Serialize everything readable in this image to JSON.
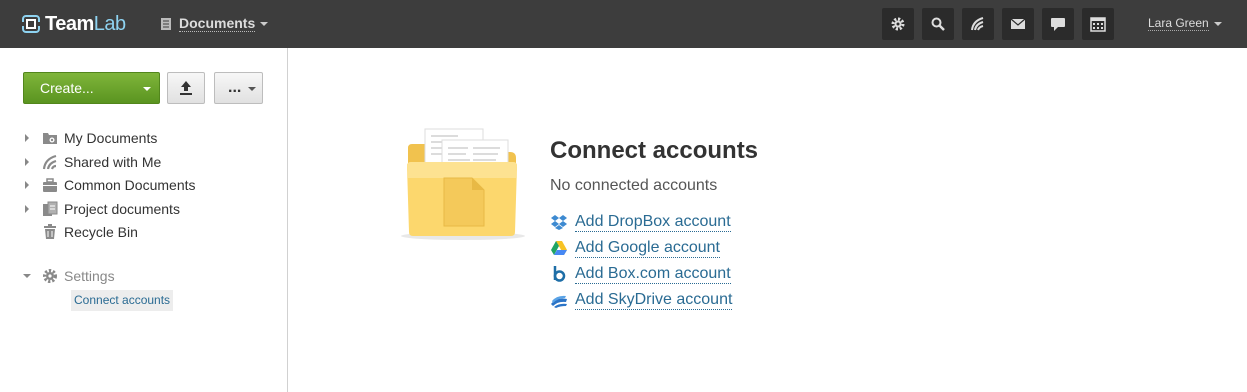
{
  "header": {
    "logo_team": "Team",
    "logo_lab": "Lab",
    "module_label": "Documents",
    "user_name": "Lara Green",
    "toolbar_icons": [
      "settings-icon",
      "search-icon",
      "feed-icon",
      "mail-icon",
      "chat-icon",
      "calendar-icon"
    ]
  },
  "sidebar": {
    "create_label": "Create...",
    "more_label": "...",
    "tree": [
      {
        "label": "My Documents",
        "icon": "my-documents-icon",
        "expandable": true
      },
      {
        "label": "Shared with Me",
        "icon": "shared-icon",
        "expandable": true
      },
      {
        "label": "Common Documents",
        "icon": "common-documents-icon",
        "expandable": true
      },
      {
        "label": "Project documents",
        "icon": "project-documents-icon",
        "expandable": true
      },
      {
        "label": "Recycle Bin",
        "icon": "trash-icon",
        "expandable": false
      }
    ],
    "settings": {
      "label": "Settings",
      "expanded": true,
      "children": [
        "Connect accounts"
      ]
    }
  },
  "main": {
    "title": "Connect accounts",
    "subtitle": "No connected accounts",
    "accounts": [
      {
        "label": "Add DropBox account",
        "icon": "dropbox-icon"
      },
      {
        "label": "Add Google account",
        "icon": "google-drive-icon"
      },
      {
        "label": "Add Box.com account",
        "icon": "box-icon"
      },
      {
        "label": "Add SkyDrive account",
        "icon": "skydrive-icon"
      }
    ]
  },
  "colors": {
    "topbar": "#3d3d3d",
    "create_button": "#6aa52c",
    "link": "#2a6b93",
    "selected_item_bg": "#ededed"
  }
}
